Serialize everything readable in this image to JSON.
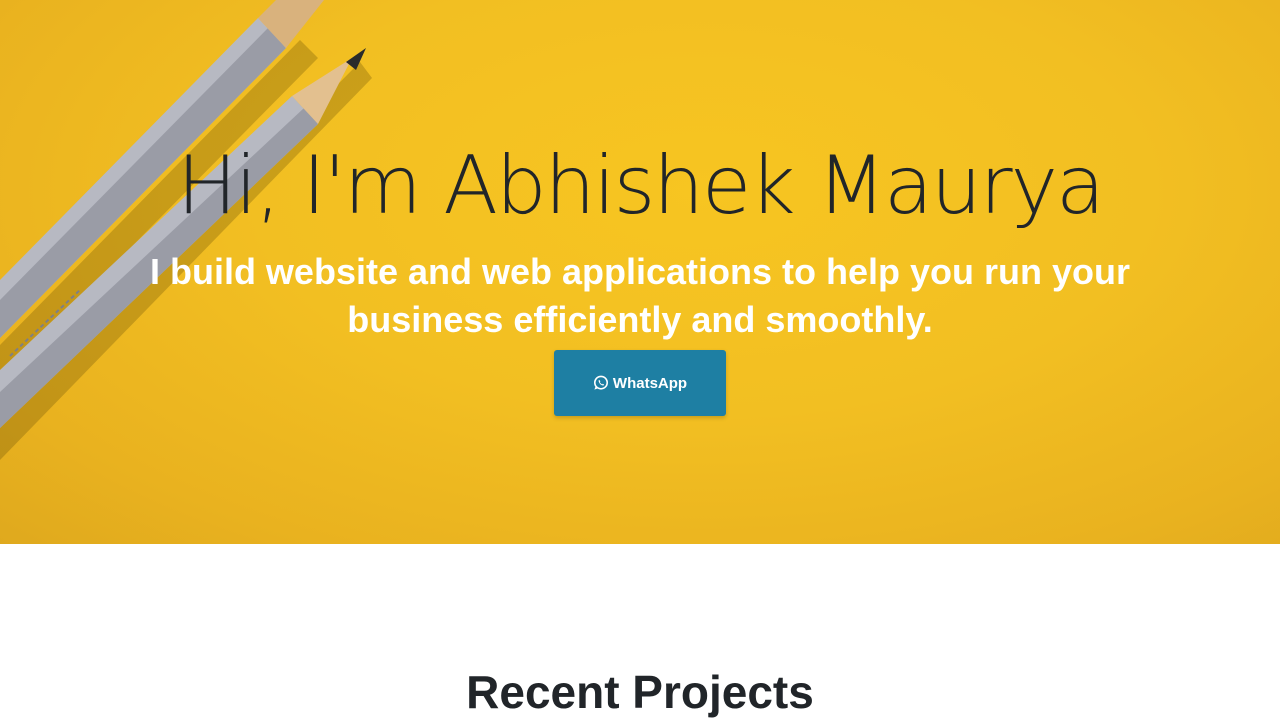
{
  "hero": {
    "title": "Hi, I'm Abhishek Maurya",
    "subtitle": "I build website and web applications to help you run your business efficiently and smoothly.",
    "background_color": "#f2bf22",
    "cta": {
      "label": "WhatsApp",
      "icon": "whatsapp-icon",
      "color": "#1e7fa3"
    }
  },
  "projects": {
    "heading": "Recent Projects"
  }
}
